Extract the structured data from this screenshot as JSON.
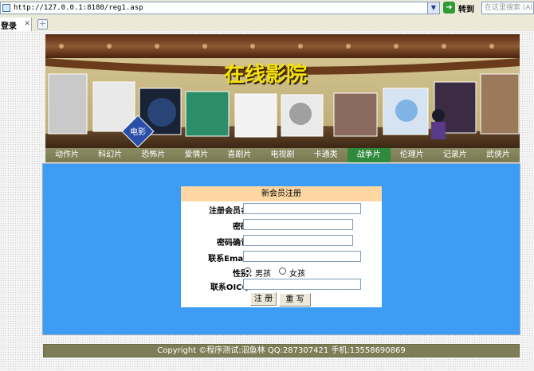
{
  "browser": {
    "url": "http://127.0.0.1:8180/reg1.asp",
    "go_label": "转到",
    "search_placeholder": "在这里搜索 (Al",
    "tab_label": "登录",
    "tab_close": "×",
    "new_tab": "+"
  },
  "banner": {
    "title": "在线影院",
    "seal_text": "电影"
  },
  "nav": {
    "items": [
      "动作片",
      "科幻片",
      "恐怖片",
      "爱情片",
      "喜剧片",
      "电视剧",
      "卡通类",
      "战争片",
      "伦理片",
      "记录片",
      "武侠片"
    ],
    "active_index": 7
  },
  "form": {
    "heading": "新会员注册",
    "username_label": "注册会员名：",
    "password_label": "密码：",
    "confirm_label": "密码确认：",
    "email_label": "联系Email：",
    "gender_label": "性别：",
    "gender_options": [
      "男孩",
      "女孩"
    ],
    "gender_selected": "男孩",
    "qq_label": "联系OICQ：",
    "submit_label": "注 册",
    "reset_label": "重 写"
  },
  "footer": {
    "text": "Copyright ©程序测试:泅鱼林  QQ:287307421 手机:13558690869"
  },
  "colors": {
    "panel_bg": "#3d9df5",
    "nav_bg": "#7a7a52",
    "nav_active": "#2f8a3b",
    "form_header": "#fdd6a2",
    "footer_bg": "#7d7d57"
  }
}
